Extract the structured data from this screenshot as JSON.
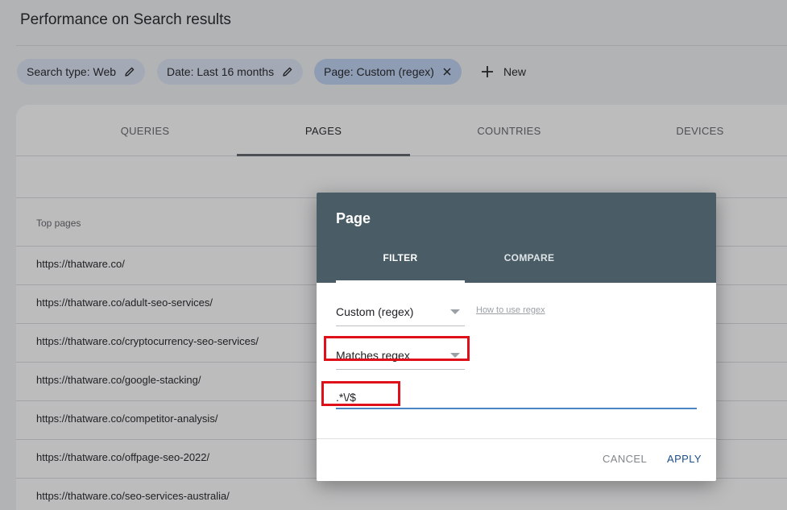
{
  "header": {
    "title": "Performance on Search results"
  },
  "filters": {
    "chips": [
      {
        "label": "Search type: Web"
      },
      {
        "label": "Date: Last 16 months"
      },
      {
        "label": "Page: Custom (regex)"
      }
    ],
    "new_label": "New"
  },
  "tabs": [
    {
      "label": "QUERIES"
    },
    {
      "label": "PAGES",
      "active": true
    },
    {
      "label": "COUNTRIES"
    },
    {
      "label": "DEVICES"
    }
  ],
  "table": {
    "column_header": "Top pages",
    "rows": [
      "https://thatware.co/",
      "https://thatware.co/adult-seo-services/",
      "https://thatware.co/cryptocurrency-seo-services/",
      "https://thatware.co/google-stacking/",
      "https://thatware.co/competitor-analysis/",
      "https://thatware.co/offpage-seo-2022/",
      "https://thatware.co/seo-services-australia/"
    ]
  },
  "dialog": {
    "title": "Page",
    "tabs": {
      "filter": "FILTER",
      "compare": "COMPARE"
    },
    "type_select": "Custom (regex)",
    "help_link": "How to use regex",
    "match_select": "Matches regex",
    "regex_value": ".*\\/$",
    "cancel_label": "CANCEL",
    "apply_label": "APPLY"
  },
  "colors": {
    "dialog_header": "#4a5c66",
    "highlight": "#e0101a",
    "apply": "#1a4f8a"
  }
}
